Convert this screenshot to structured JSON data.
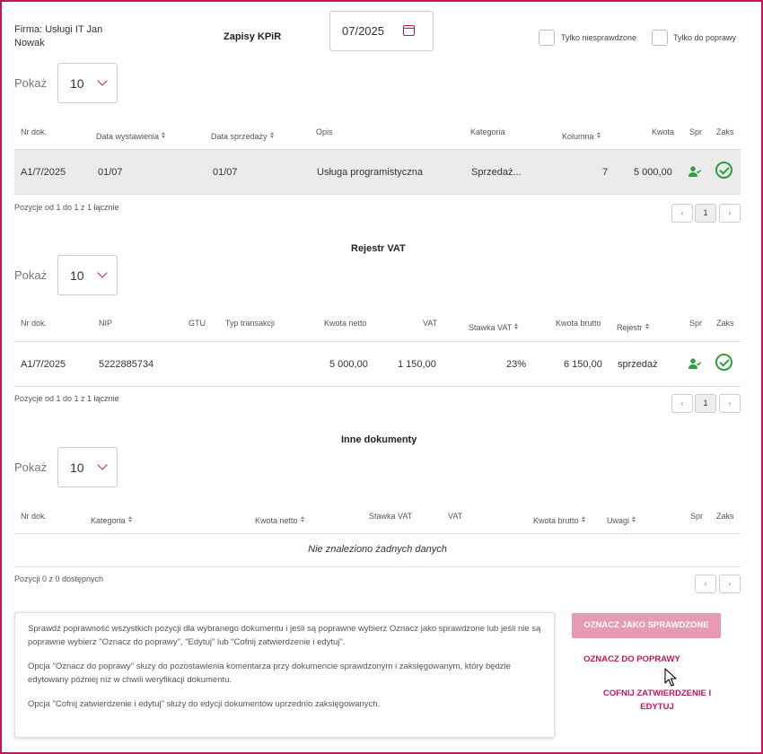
{
  "header": {
    "firm": "Firma: Usługi IT Jan Nowak",
    "title": "Zapisy KPiR",
    "month": "07/2025",
    "filter_unchecked": "Tylko niesprawdzone",
    "filter_to_fix": "Tylko do poprawy"
  },
  "kpir": {
    "show_label": "Pokaż",
    "page_size": "10",
    "columns": [
      "Nr dok.",
      "Data wystawienia",
      "Data sprzedaży",
      "Opis",
      "Kategoria",
      "Kolumna",
      "Kwota",
      "Spr",
      "Zaks"
    ],
    "rows": [
      {
        "nr": "A1/7/2025",
        "data_wyst": "01/07",
        "data_sprz": "01/07",
        "opis": "Usługa programistyczna",
        "kategoria": "Sprzedaż...",
        "kolumna": "7",
        "kwota": "5 000,00"
      }
    ],
    "info": "Pozycje od 1 do 1 z 1 łącznie",
    "page": "1"
  },
  "vat": {
    "title": "Rejestr VAT",
    "show_label": "Pokaż",
    "page_size": "10",
    "columns": [
      "Nr dok.",
      "NIP",
      "GTU",
      "Typ transakcji",
      "Kwota netto",
      "VAT",
      "Stawka VAT",
      "Kwota brutto",
      "Rejestr",
      "Spr",
      "Zaks"
    ],
    "rows": [
      {
        "nr": "A1/7/2025",
        "nip": "5222885734",
        "gtu": "",
        "typ": "",
        "netto": "5 000,00",
        "vat": "1 150,00",
        "stawka": "23%",
        "brutto": "6 150,00",
        "rejestr": "sprzedaż"
      }
    ],
    "info": "Pozycje od 1 do 1 z 1 łącznie",
    "page": "1"
  },
  "other": {
    "title": "Inne dokumenty",
    "show_label": "Pokaż",
    "page_size": "10",
    "columns": [
      "Nr dok.",
      "Kategoria",
      "Kwota netto",
      "Stawka VAT",
      "VAT",
      "Kwota brutto",
      "Uwagi",
      "Spr",
      "Zaks"
    ],
    "no_data": "Nie znaleziono żadnych danych",
    "info": "Pozycji 0 z 0 dostępnych"
  },
  "help": {
    "p1": "Sprawdź poprawność wszystkich pozycji dla wybranego dokumentu i jeśli są poprawne wybierz Oznacz jako sprawdzone lub jeśli nie są poprawne wybierz \"Oznacz do poprawy\", \"Edytuj\" lub \"Cofnij zatwierdzenie i edytuj\".",
    "p2": "Opcja \"Oznacz do poprawy\" służy do pozostawienia komentarza przy dokumencie sprawdzonym i zaksięgowanym, który będzie edytowany później niż w chwili weryfikacji dokumentu.",
    "p3": "Opcja \"Cofnij zatwierdzenie i edytuj\" służy do edycji dokumentów uprzednio zaksięgowanych."
  },
  "actions": {
    "mark_checked": "OZNACZ JAKO SPRAWDZONE",
    "mark_fix": "OZNACZ DO POPRAWY",
    "revert_edit": "COFNIJ ZATWIERDZENIE I EDYTUJ"
  },
  "icons": {
    "calendar": "calendar-icon",
    "person_check": "person-check-icon",
    "check_circle": "check-circle-icon",
    "prev": "chevron-left-icon",
    "next": "chevron-right-icon",
    "cursor": "mouse-pointer-icon"
  },
  "colors": {
    "accent": "#c2185b",
    "success": "#2e9e3e",
    "button_disabled": "#e89ab5"
  }
}
